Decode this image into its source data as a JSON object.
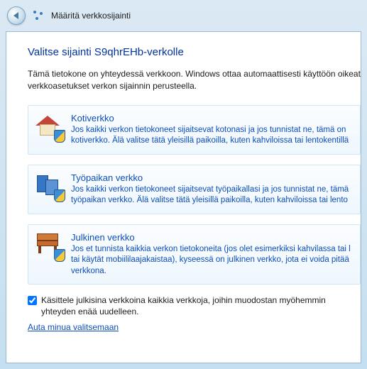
{
  "window": {
    "title": "Määritä verkkosijainti"
  },
  "page": {
    "heading": "Valitse sijainti S9qhrEHb-verkolle",
    "intro": "Tämä tietokone on yhteydessä verkkoon. Windows ottaa automaattisesti käyttöön oikeat verkkoasetukset verkon sijainnin perusteella."
  },
  "options": {
    "home": {
      "title": "Kotiverkko",
      "desc": "Jos kaikki verkon tietokoneet sijaitsevat kotonasi ja jos tunnistat ne, tämä on kotiverkko. Älä valitse tätä yleisillä paikoilla, kuten kahviloissa tai lentokentillä"
    },
    "work": {
      "title": "Työpaikan verkko",
      "desc": "Jos kaikki verkon tietokoneet sijaitsevat työpaikallasi ja jos tunnistat ne, tämä työpaikan verkko. Älä valitse tätä yleisillä paikoilla, kuten kahviloissa tai lento"
    },
    "public": {
      "title": "Julkinen verkko",
      "desc": "Jos et tunnista kaikkia verkon tietokoneita (jos olet esimerkiksi kahvilassa tai l tai käytät mobiililaajakaistaa), kyseessä on julkinen verkko, jota ei voida pitää verkkona."
    }
  },
  "checkbox": {
    "label": "Käsittele julkisina verkkoina kaikkia verkkoja, joihin muodostan myöhemmin yhteyden enää uudelleen."
  },
  "help": {
    "label": "Auta minua valitsemaan"
  }
}
